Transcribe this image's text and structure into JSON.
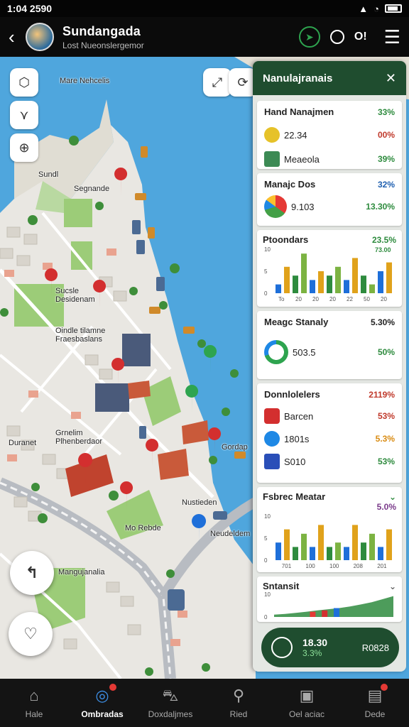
{
  "status_bar": {
    "time": "1:04 2590"
  },
  "app_bar": {
    "title": "Sundangada",
    "subtitle": "Lost Nueonslergemor",
    "toggle_text": "O!"
  },
  "map": {
    "labels": {
      "top_harbor": "Mare Nehcelis",
      "area_1": "Sundl",
      "area_2": "Segnande",
      "area_3": "Sucsle Desidenam",
      "area_4": "Oindle tilamne Fraesbaslans",
      "area_5": "Duranet",
      "area_6": "Grnelim Plhenberdaor",
      "area_7": "Gordap",
      "area_8": "Nustieden",
      "area_9": "Mo Rebde",
      "area_10": "Neudeldem",
      "area_11": "Mangujanalia"
    }
  },
  "panel": {
    "title": "Nanulajranais",
    "card1": {
      "header": "Hand Nanajmen",
      "header_pct": "33%",
      "rows": [
        {
          "label": "22.34",
          "pct": "00%"
        },
        {
          "label": "Meaeola",
          "pct": "39%"
        }
      ]
    },
    "card2": {
      "header": "Manajc Dos",
      "header_pct": "32%",
      "value": "9.103",
      "value_pct": "13.30%"
    },
    "card3": {
      "header": "Ptoondars",
      "header_pct": "23.5%",
      "sub_pct": "73.00",
      "y_ticks": [
        "10",
        "5",
        "0"
      ],
      "x_ticks": [
        "To",
        "20",
        "20",
        "20",
        "22",
        "50",
        "20"
      ]
    },
    "card4": {
      "header": "Meagc Stanaly",
      "header_pct": "5.30%",
      "value": "503.5",
      "value_pct": "50%"
    },
    "card5": {
      "header": "Donnlolelers",
      "header_pct": "2119%",
      "rows": [
        {
          "label": "Barcen",
          "pct": "53%"
        },
        {
          "label": "1801s",
          "pct": "5.3%"
        },
        {
          "label": "S010",
          "pct": "53%"
        }
      ]
    },
    "card6": {
      "header": "Fsbrec Meatar",
      "header_pct": "5.0%",
      "y_ticks": [
        "10",
        "5",
        "0"
      ],
      "x_ticks": [
        "701",
        "100",
        "100",
        "208",
        "201"
      ]
    },
    "card7": {
      "header": "Sntansit",
      "y_ticks": [
        "10",
        "0"
      ]
    },
    "summary": {
      "value": "18.30",
      "pct": "3.3%",
      "code": "R0828"
    }
  },
  "bottom_nav": [
    {
      "label": "Hale",
      "icon": "home-icon"
    },
    {
      "label": "Ombradas",
      "icon": "compass-icon"
    },
    {
      "label": "Doxdaljmes",
      "icon": "car-icon"
    },
    {
      "label": "Ried",
      "icon": "search-icon"
    },
    {
      "label": "Oel aciac",
      "icon": "calendar-icon"
    },
    {
      "label": "Dede",
      "icon": "report-icon"
    }
  ],
  "chart_data": [
    {
      "type": "bar",
      "title": "Ptoondars",
      "ylim": [
        0,
        10
      ],
      "categories": [
        "To",
        "20",
        "20",
        "20",
        "22",
        "50",
        "20"
      ],
      "series": [
        {
          "values": [
            2,
            6,
            4,
            9,
            3,
            5,
            4,
            6,
            3,
            8,
            4,
            2,
            5,
            7
          ]
        }
      ]
    },
    {
      "type": "bar",
      "title": "Fsbrec Meatar",
      "ylim": [
        0,
        10
      ],
      "categories": [
        "701",
        "100",
        "100",
        "208",
        "201"
      ],
      "series": [
        {
          "values": [
            4,
            7,
            3,
            6,
            3,
            8,
            3,
            4,
            3,
            8,
            4,
            6,
            3,
            7
          ]
        }
      ]
    },
    {
      "type": "area",
      "title": "Sntansit",
      "ylim": [
        0,
        10
      ],
      "series": [
        {
          "values": [
            1,
            1.3,
            1.8,
            2.3,
            2.9,
            3.4,
            3.9,
            4.6,
            5.5,
            6.5,
            7.8,
            9.2
          ]
        }
      ]
    }
  ]
}
